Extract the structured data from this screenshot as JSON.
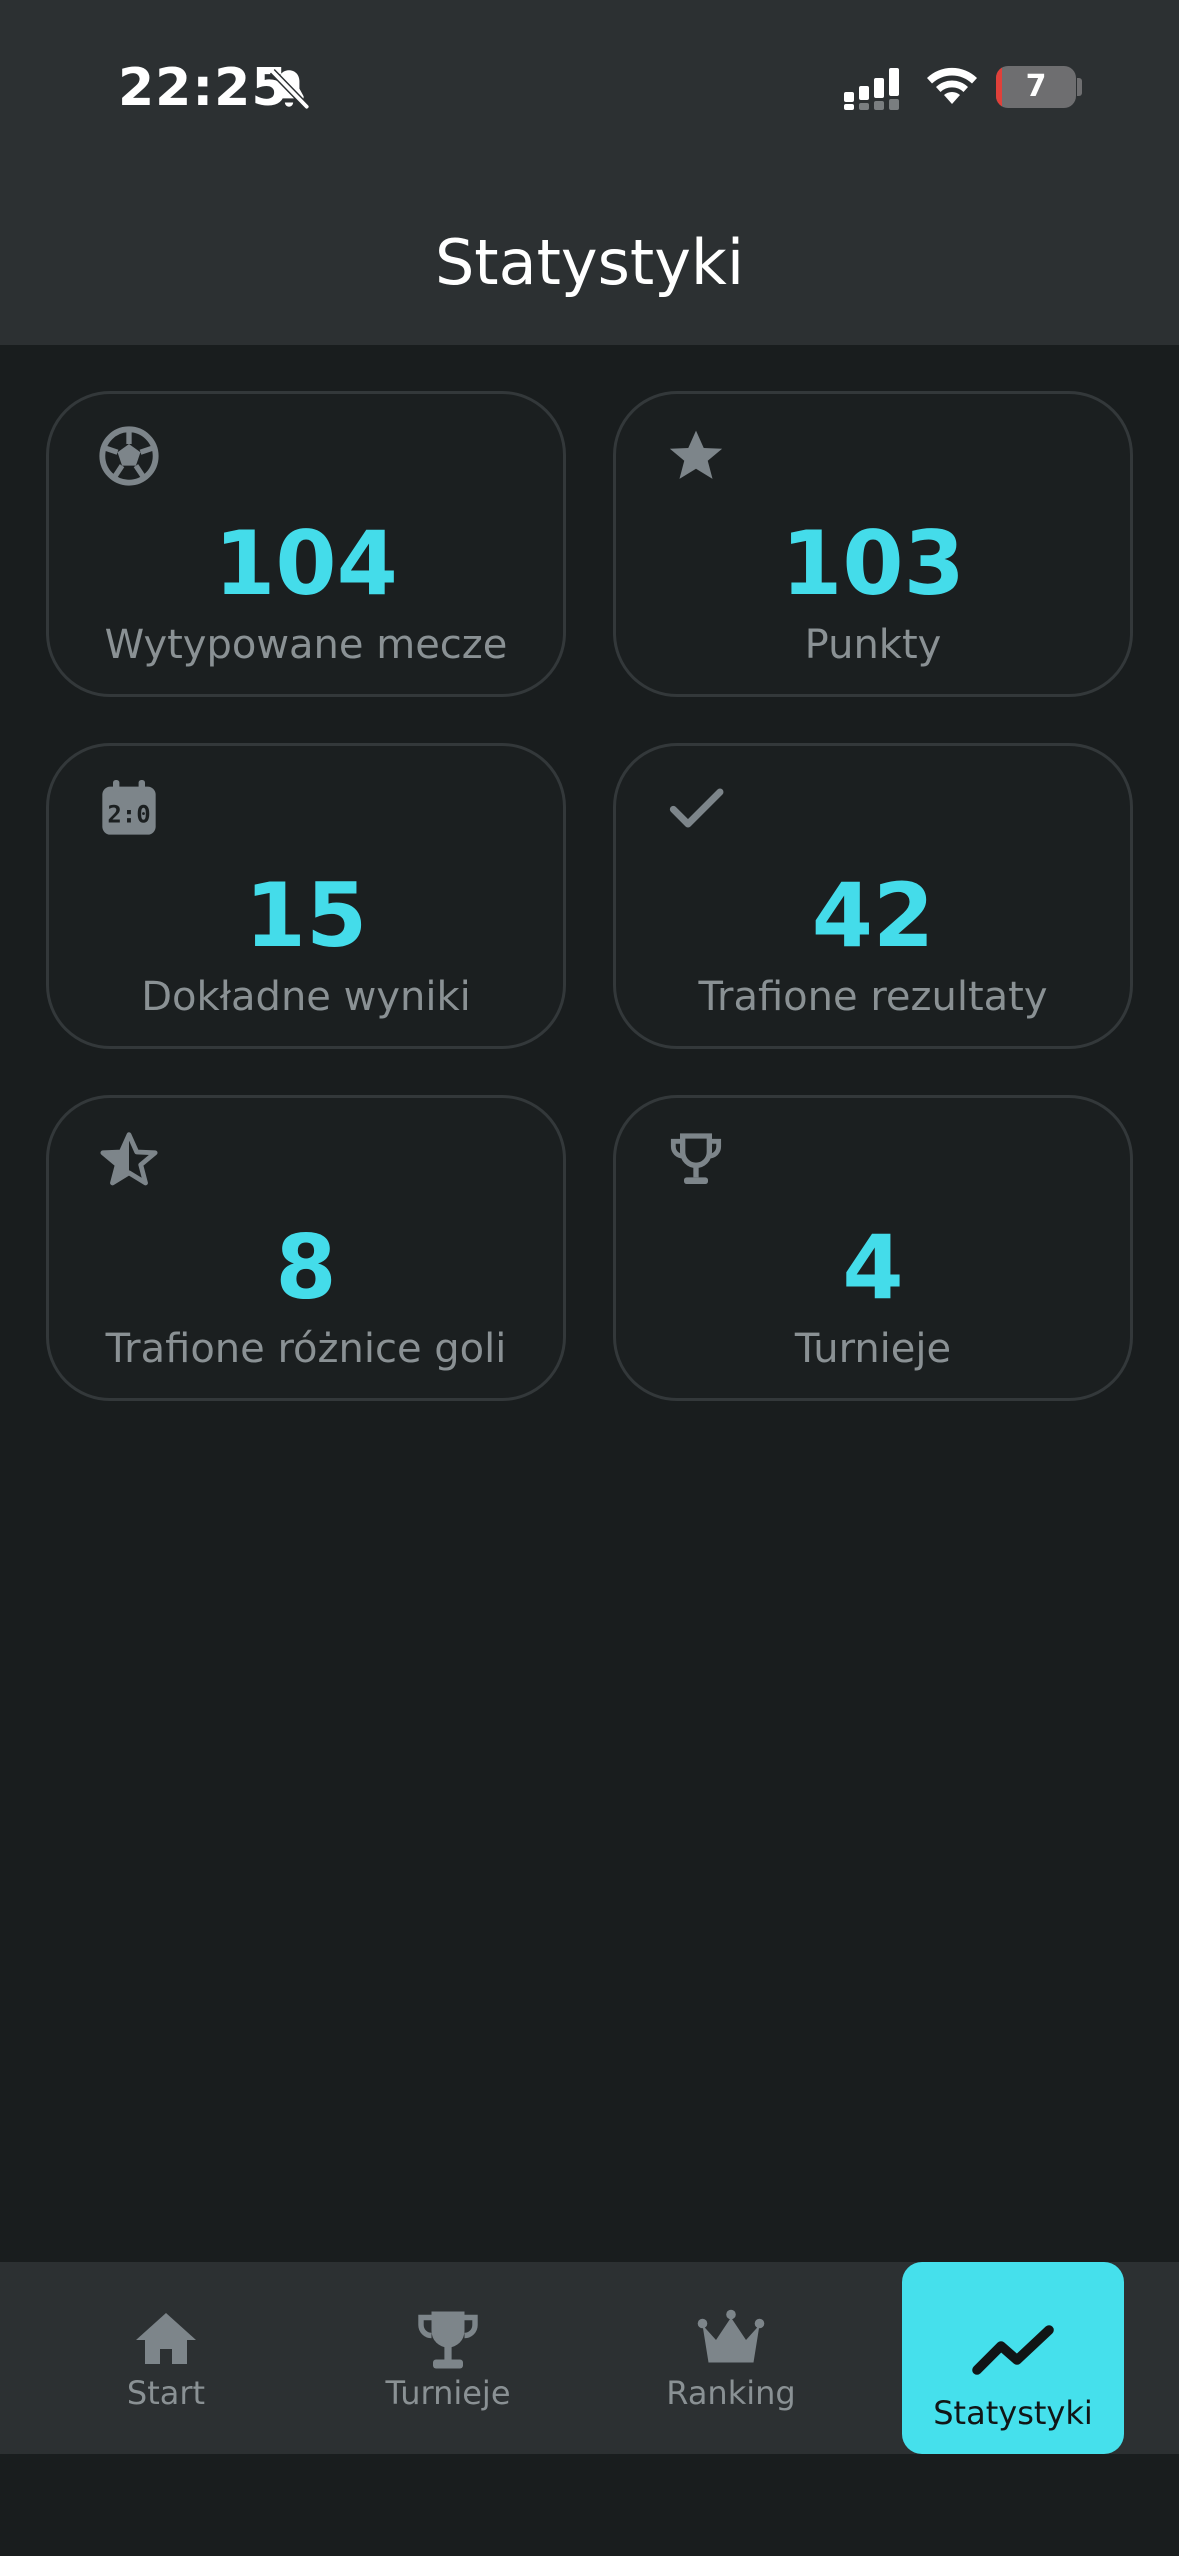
{
  "status_bar": {
    "time": "22:25",
    "battery_level": "7",
    "icons": [
      "bell-slash-icon",
      "signal-icon",
      "wifi-icon",
      "battery-icon"
    ]
  },
  "header": {
    "title": "Statystyki"
  },
  "stats": [
    {
      "icon": "soccer-ball-icon",
      "value": "104",
      "label": "Wytypowane mecze"
    },
    {
      "icon": "star-icon",
      "value": "103",
      "label": "Punkty"
    },
    {
      "icon": "scoreboard-icon",
      "value": "15",
      "label": "Dokładne wyniki"
    },
    {
      "icon": "check-icon",
      "value": "42",
      "label": "Trafione rezultaty"
    },
    {
      "icon": "star-half-icon",
      "value": "8",
      "label": "Trafione różnice goli"
    },
    {
      "icon": "trophy-icon",
      "value": "4",
      "label": "Turnieje"
    }
  ],
  "nav": {
    "items": [
      {
        "icon": "home-icon",
        "label": "Start",
        "active": false
      },
      {
        "icon": "trophy-icon",
        "label": "Turnieje",
        "active": false
      },
      {
        "icon": "crown-icon",
        "label": "Ranking",
        "active": false
      },
      {
        "icon": "trend-up-icon",
        "label": "Statystyki",
        "active": true
      }
    ]
  },
  "colors": {
    "accent": "#44dcea",
    "background": "#191d1e",
    "header": "#2c3032",
    "muted_text": "#8a9194"
  }
}
